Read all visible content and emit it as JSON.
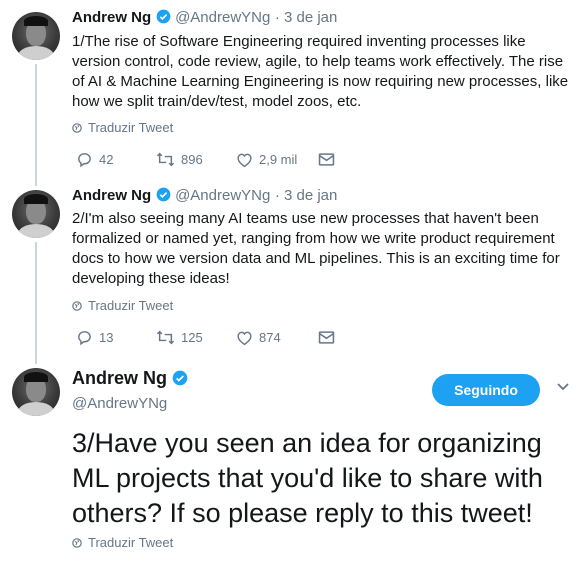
{
  "tweets": [
    {
      "name": "Andrew Ng",
      "handle": "@AndrewYNg",
      "date": "· 3 de jan",
      "text": "1/The rise of Software Engineering required inventing processes like version control, code review, agile, to help teams work effectively. The rise of AI & Machine Learning Engineering is now requiring new processes, like how we split train/dev/test, model zoos, etc.",
      "translate": "Traduzir Tweet",
      "replies": "42",
      "retweets": "896",
      "likes": "2,9 mil"
    },
    {
      "name": "Andrew Ng",
      "handle": "@AndrewYNg",
      "date": "· 3 de jan",
      "text": "2/I'm also seeing many AI teams use new processes that haven't been formalized or named yet, ranging from how we write product requirement docs to how we version data and ML pipelines. This is an exciting time for developing these ideas!",
      "translate": "Traduzir Tweet",
      "replies": "13",
      "retweets": "125",
      "likes": "874"
    }
  ],
  "main_tweet": {
    "name": "Andrew Ng",
    "handle": "@AndrewYNg",
    "follow_label": "Seguindo",
    "text": "3/Have you seen an idea for organizing ML projects that you'd like to share with others? If so please reply to this tweet!",
    "translate": "Traduzir Tweet"
  },
  "colors": {
    "accent": "#1da1f2",
    "muted": "#657786",
    "line": "#ccd6dd"
  },
  "icons": [
    "verified-badge-icon",
    "globe-icon",
    "reply-icon",
    "retweet-icon",
    "like-icon",
    "direct-message-icon",
    "chevron-down-icon"
  ]
}
